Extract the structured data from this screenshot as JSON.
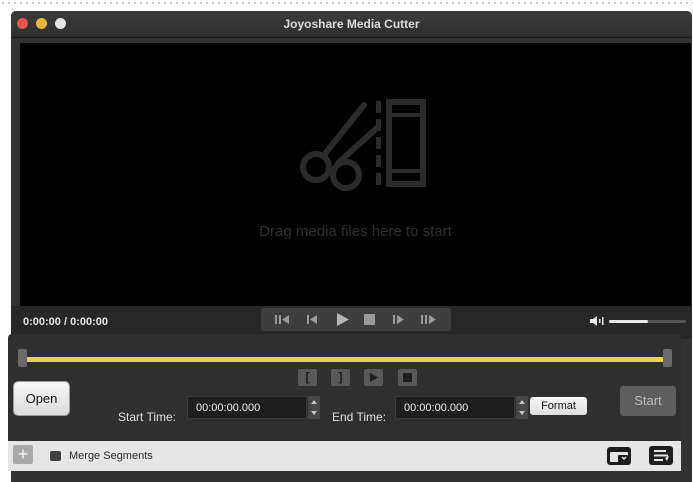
{
  "window": {
    "title": "Joyoshare Media Cutter"
  },
  "player": {
    "drop_text": "Drag media files here to start",
    "timecode": "0:00:00 / 0:00:00",
    "volume_level": 0.5
  },
  "transport": {
    "buttons": [
      "prev-frame-icon",
      "step-back-icon",
      "play-icon",
      "stop-icon",
      "step-forward-icon",
      "next-frame-icon"
    ]
  },
  "editor": {
    "cut_buttons": [
      "[",
      "]"
    ],
    "open_label": "Open",
    "start_time_label": "Start Time:",
    "start_time_value": "00:00:00.000",
    "end_time_label": "End Time:",
    "end_time_value": "00:00:00.000",
    "format_label": "Format",
    "start_label": "Start"
  },
  "bottom": {
    "add_label": "+",
    "merge_label": "Merge Segments"
  },
  "colors": {
    "timeline": "#e3d257",
    "window_bg": "#323232",
    "close": "#e9534b",
    "minimize": "#e8b63c"
  }
}
